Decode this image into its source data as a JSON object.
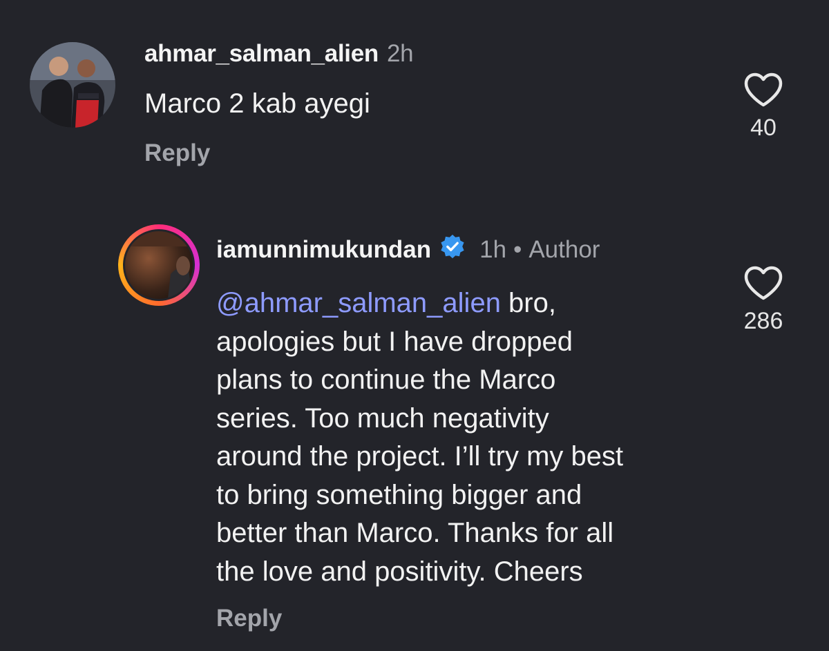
{
  "comments": [
    {
      "username": "ahmar_salman_alien",
      "time": "2h",
      "text": "Marco 2 kab ayegi",
      "reply_label": "Reply",
      "likes": "40",
      "avatar_icon": "avatar-photo"
    },
    {
      "username": "iamunnimukundan",
      "verified_icon": "verified-badge-icon",
      "time": "1h",
      "separator": "•",
      "badge": "Author",
      "mention": "@ahmar_salman_alien",
      "lines": [
        " bro,",
        "apologies but I have dropped",
        "plans to continue the Marco",
        "series. Too much negativity",
        "around the project. I’ll try my best",
        "to bring something bigger and",
        "better than Marco. Thanks for all",
        "the love and positivity. Cheers"
      ],
      "reply_label": "Reply",
      "likes": "286",
      "story_ring_colors": [
        "#ff2d78",
        "#d62fd3",
        "#ff6a2c",
        "#ffb31a"
      ]
    }
  ],
  "colors": {
    "background": "#23242a",
    "muted": "#a3a5ab",
    "mention": "#8e9bff",
    "verified": "#3897f0"
  }
}
